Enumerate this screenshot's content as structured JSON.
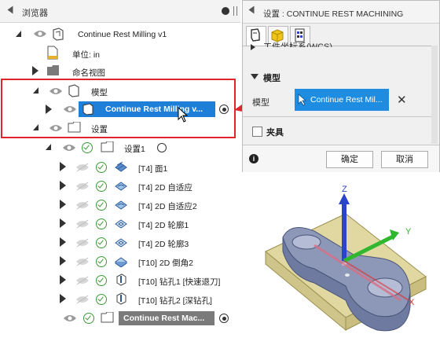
{
  "browser": {
    "title": "浏览器",
    "rows": {
      "root": "Continue Rest Milling v1",
      "units": "单位: in",
      "named_views": "命名视图",
      "model": "模型",
      "model_child": "Continue Rest Milling v...",
      "setups": "设置",
      "setup1": "设置1",
      "op1": "[T4] 面1",
      "op2": "[T4] 2D 自适应",
      "op3": "[T4] 2D 自适应2",
      "op4": "[T4] 2D 轮廓1",
      "op5": "[T4] 2D 轮廓3",
      "op6": "[T10] 2D 倒角2",
      "op7": "[T10] 钻孔1 [快速退刀]",
      "op8": "[T10] 钻孔2 [深钻孔]",
      "op9": "Continue Rest Mac..."
    }
  },
  "settings": {
    "title": "设置 : CONTINUE REST MACHINING",
    "cut_header": "工件坐标系(WCS)",
    "model_section": "模型",
    "model_label": "模型",
    "model_value": "Continue Rest Mil...",
    "fixture_label": "夹具",
    "ok": "确定",
    "cancel": "取消"
  },
  "viewport": {
    "axis_x": "X",
    "axis_y": "Y",
    "axis_z": "Z"
  },
  "colors": {
    "accent": "#1e7fd8",
    "highlight_border": "#e0262c",
    "axis_x": "#e03030",
    "axis_y": "#2fb82f",
    "axis_z": "#2a44cc",
    "stock": "#d9d29b",
    "part": "#8a95b5"
  }
}
